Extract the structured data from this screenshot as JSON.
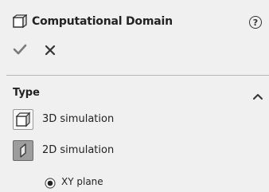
{
  "header": {
    "title": "Computational Domain",
    "icon": "computational-domain-icon",
    "help_icon": "help-icon",
    "help_glyph": "?"
  },
  "actions": {
    "ok_icon": "checkmark-icon",
    "ok_glyph": "✔",
    "cancel_icon": "close-icon",
    "cancel_glyph": "✕"
  },
  "type_section": {
    "title": "Type",
    "collapse_icon": "chevron-up-icon",
    "options": [
      {
        "label": "3D simulation",
        "icon": "cube-3d-icon",
        "selected": false
      },
      {
        "label": "2D simulation",
        "icon": "plane-2d-icon",
        "selected": true
      }
    ],
    "plane": {
      "label": "XY plane",
      "checked": true
    }
  },
  "colors": {
    "background": "#f0f0f0",
    "check": "#7a7a7a",
    "selected_icon_bg": "#9d9d9d"
  }
}
